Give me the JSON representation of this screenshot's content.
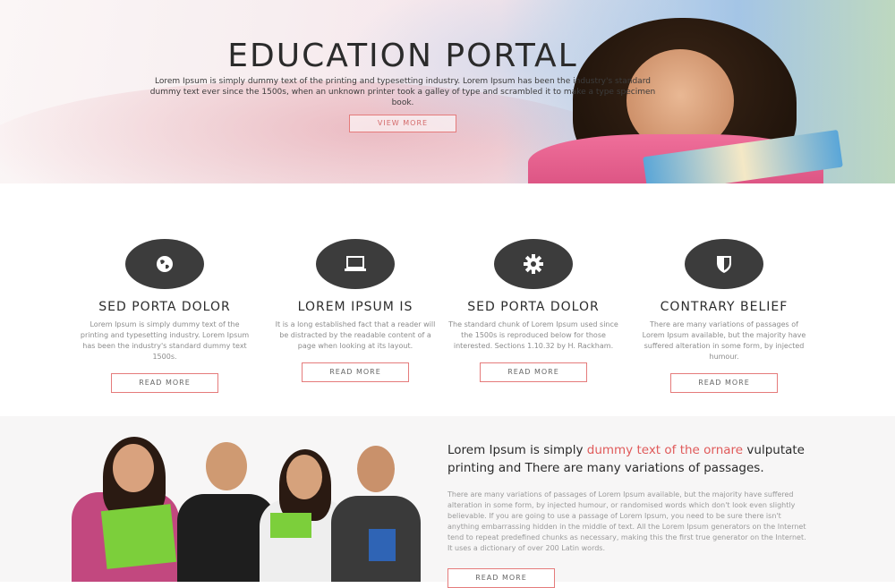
{
  "hero": {
    "title": "EDUCATION PORTAL",
    "text": "Lorem Ipsum is simply dummy text of the printing and typesetting industry. Lorem Ipsum has been the industry's standard dummy text ever since the 1500s, when an unknown printer took a galley of type and scrambled it to make a type specimen book.",
    "button_label": "VIEW MORE"
  },
  "features": [
    {
      "icon": "globe-icon",
      "title": "SED PORTA DOLOR",
      "text": "Lorem Ipsum is simply dummy text of the printing and typesetting industry. Lorem Ipsum has been the industry's standard dummy text 1500s.",
      "button_label": "READ MORE"
    },
    {
      "icon": "laptop-icon",
      "title": "LOREM IPSUM IS",
      "text": "It is a long established fact that a reader will be distracted by the readable content of a page when looking at its layout.",
      "button_label": "READ MORE"
    },
    {
      "icon": "gear-icon",
      "title": "SED PORTA DOLOR",
      "text": "The standard chunk of Lorem Ipsum used since the 1500s is reproduced below for those interested. Sections 1.10.32 by H. Rackham.",
      "button_label": "READ MORE"
    },
    {
      "icon": "shield-icon",
      "title": "CONTRARY BELIEF",
      "text": "There are many variations of passages of Lorem Ipsum available, but the majority have suffered alteration in some form, by injected humour.",
      "button_label": "READ MORE"
    }
  ],
  "about": {
    "title_part1": "Lorem Ipsum is simply ",
    "title_highlight": "dummy text of the ornare",
    "title_part2": " vulputate printing and There are many variations of passages.",
    "text": "There are many variations of passages of Lorem Ipsum available, but the majority have suffered alteration in some form, by injected humour, or randomised words which don't look even slightly believable. If you are going to use a passage of Lorem Ipsum, you need to be sure there isn't anything embarrassing hidden in the middle of text. All the Lorem Ipsum generators on the Internet tend to repeat predefined chunks as necessary, making this the first true generator on the Internet. It uses a dictionary of over 200 Latin words.",
    "button_label": "READ MORE"
  },
  "colors": {
    "accent": "#e05a5a",
    "icon_circle": "#3c3c3c"
  }
}
